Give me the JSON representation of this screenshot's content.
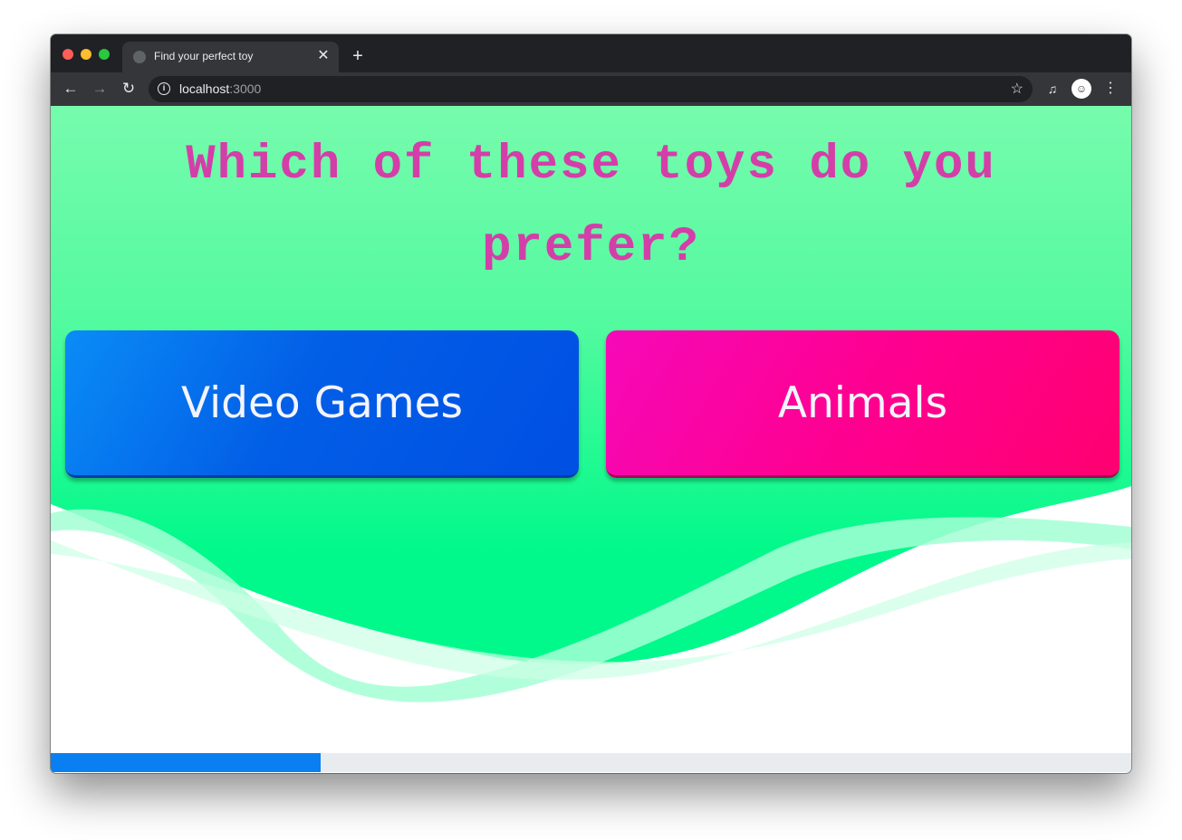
{
  "browser": {
    "tab_title": "Find your perfect toy",
    "url_host": "localhost",
    "url_port": ":3000"
  },
  "page": {
    "question": "Which of these toys do you prefer?",
    "choices": [
      {
        "label": "Video Games",
        "color": "#025ee6"
      },
      {
        "label": "Animals",
        "color": "#fe0090"
      }
    ],
    "progress": 0.25,
    "colors": {
      "background_green": "#00f98a",
      "question_text": "#d43ea9",
      "progress_fill": "#0a7ff2"
    }
  }
}
